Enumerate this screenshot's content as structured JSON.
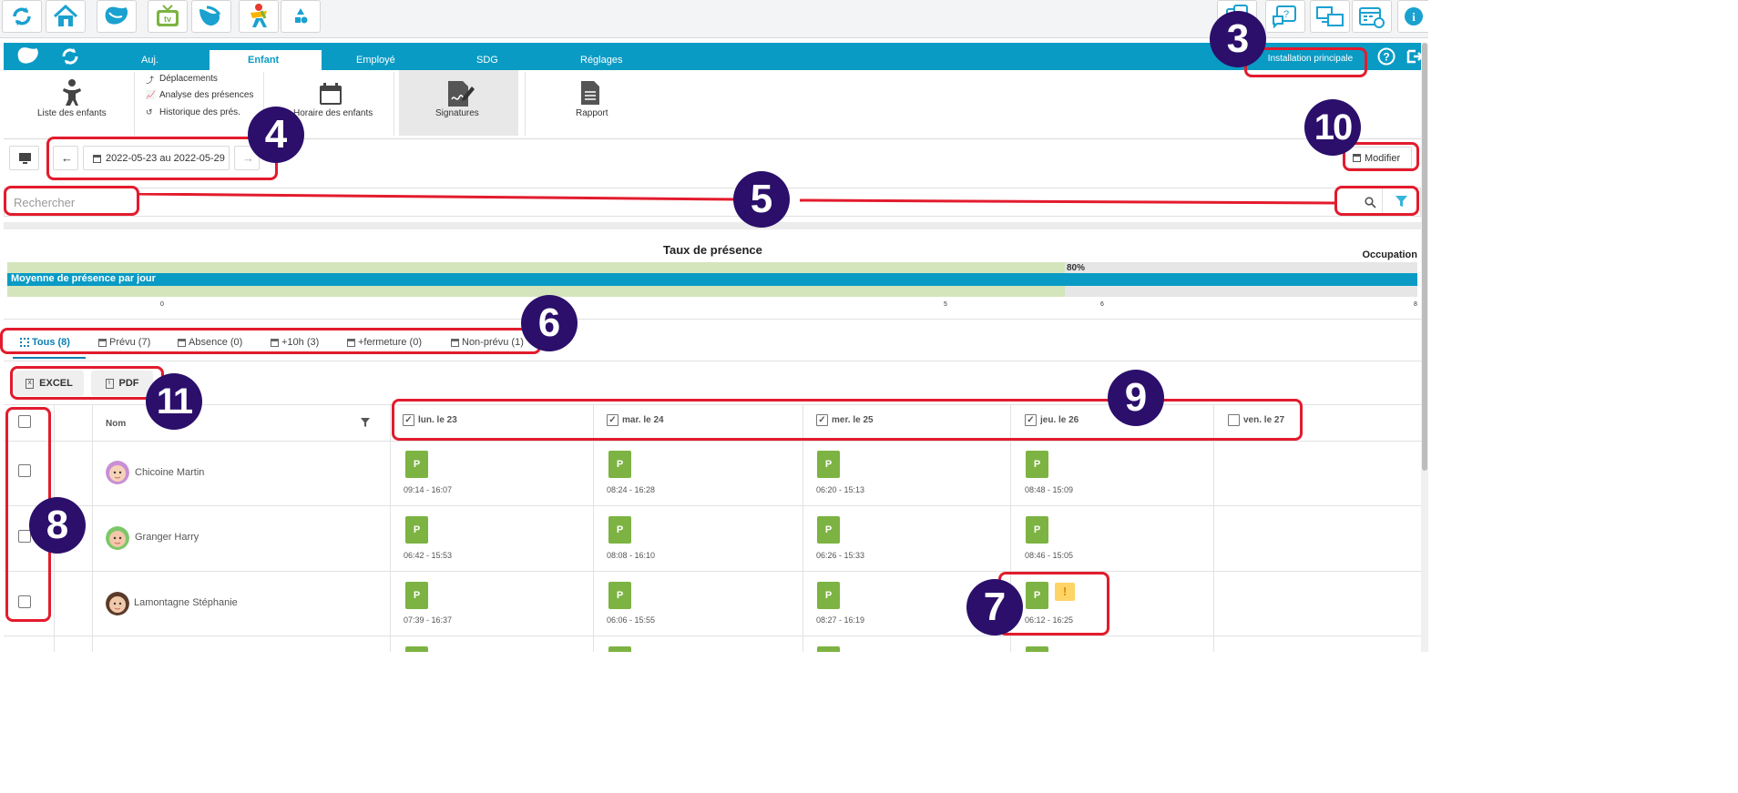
{
  "topbar": {
    "icons": [
      "refresh-icon",
      "home-icon",
      "app-logo-icon",
      "tv-icon",
      "app-logo-alt-icon",
      "kids-icon",
      "shapes-icon"
    ],
    "right_icons": [
      "message-icon",
      "help-chat-icon",
      "screens-icon",
      "calendar-clock-icon",
      "info-icon"
    ],
    "tv_label": "tv"
  },
  "nav": {
    "tabs": [
      "Auj.",
      "Enfant",
      "Employé",
      "SDG",
      "Réglages"
    ],
    "active_tab": "Enfant",
    "installation": "Installation principale"
  },
  "ribbon": {
    "list_children": "Liste des enfants",
    "links": [
      "Déplacements",
      "Analyse des présences",
      "Historique des prés."
    ],
    "schedule": "Horaire des enfants",
    "signatures": "Signatures",
    "report": "Rapport"
  },
  "toolbar": {
    "date_range": "2022-05-23 au 2022-05-29",
    "modify": "Modifier"
  },
  "search": {
    "placeholder": "Rechercher"
  },
  "chart_data": {
    "type": "bar",
    "title": "Taux de présence",
    "right_label": "Occupation",
    "series": [
      {
        "name": "Moyenne de présence par jour",
        "value": 8
      },
      {
        "name": "Occupation",
        "value": 6,
        "label": "80%"
      }
    ],
    "xlim": [
      0,
      8
    ],
    "ticks": [
      "0",
      "5",
      "6",
      "8"
    ],
    "colors": {
      "presence": "#0a9bc4",
      "occupation": "#d4e5bc",
      "track": "#e6e6e6"
    }
  },
  "filters": [
    {
      "label": "Tous (8)",
      "icon": "grid-icon",
      "active": true
    },
    {
      "label": "Prévu (7)",
      "icon": "calendar-icon"
    },
    {
      "label": "Absence (0)",
      "icon": "calendar-icon"
    },
    {
      "label": "+10h (3)",
      "icon": "calendar-icon"
    },
    {
      "label": "+fermeture (0)",
      "icon": "calendar-icon"
    },
    {
      "label": "Non-prévu (1)",
      "icon": "calendar-icon"
    }
  ],
  "export": {
    "excel": "EXCEL",
    "pdf": "PDF"
  },
  "table": {
    "name_header": "Nom",
    "days": [
      {
        "label": "lun. le 23",
        "checked": true
      },
      {
        "label": "mar. le 24",
        "checked": true
      },
      {
        "label": "mer. le 25",
        "checked": true
      },
      {
        "label": "jeu. le 26",
        "checked": true
      },
      {
        "label": "ven. le 27",
        "checked": false
      }
    ],
    "badge": "P",
    "warning": "!",
    "rows": [
      {
        "name": "Chicoine Martin",
        "times": [
          "09:14 - 16:07",
          "08:24 - 16:28",
          "06:20 - 15:13",
          "08:48 - 15:09"
        ]
      },
      {
        "name": "Granger Harry",
        "times": [
          "06:42 - 15:53",
          "08:08 - 16:10",
          "06:26 - 15:33",
          "08:46 - 15:05"
        ]
      },
      {
        "name": "Lamontagne Stéphanie",
        "times": [
          "07:39 - 16:37",
          "06:06 - 15:55",
          "08:27 - 16:19",
          "06:12 - 16:25"
        ]
      }
    ]
  },
  "annotations": [
    "3",
    "4",
    "5",
    "6",
    "7",
    "8",
    "9",
    "10",
    "11"
  ],
  "colors": {
    "accent": "#0a9bc4",
    "present_badge": "#7cb342",
    "warning_badge": "#ffd466",
    "annotation_circle": "#2b0f6b",
    "annotation_outline": "#e31b2d"
  }
}
